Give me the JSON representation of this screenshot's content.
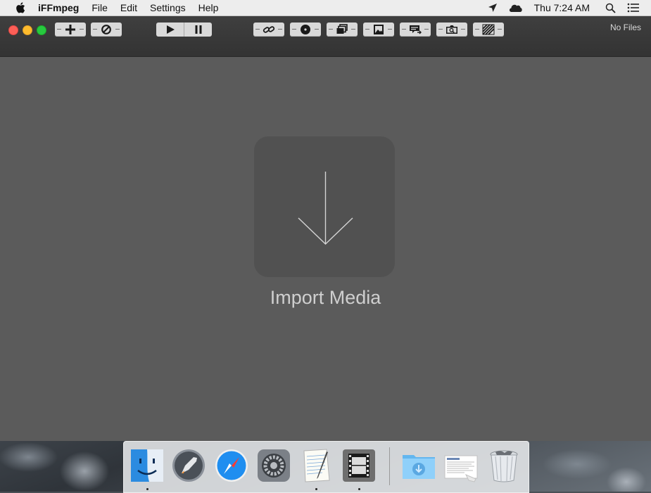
{
  "menubar": {
    "app_name": "iFFmpeg",
    "menus": [
      "File",
      "Edit",
      "Settings",
      "Help"
    ],
    "clock": "Thu 7:24 AM",
    "status_icons": [
      "location-icon",
      "cloud-icon",
      "spotlight-search-icon",
      "notification-center-icon"
    ]
  },
  "window": {
    "file_count": "No Files",
    "toolbar_buttons": [
      "add-icon",
      "cancel-icon",
      "play-icon",
      "pause-icon",
      "link-icon",
      "disc-icon",
      "layers-icon",
      "image-icon",
      "subtitle-icon",
      "screenshot-icon",
      "crop-pattern-icon"
    ]
  },
  "dropzone": {
    "label": "Import Media",
    "icon": "download-arrow-icon"
  },
  "dock": {
    "items": [
      "finder-icon",
      "launchpad-icon",
      "safari-icon",
      "system-preferences-icon",
      "textedit-icon",
      "iffmpeg-icon",
      "downloads-folder-icon",
      "document-stack-icon",
      "trash-icon"
    ]
  },
  "colors": {
    "window_bg": "#5b5b5b",
    "toolbar_bg": "#383838",
    "dropzone_bg": "#515151",
    "button_bg": "#d9d9d9"
  }
}
